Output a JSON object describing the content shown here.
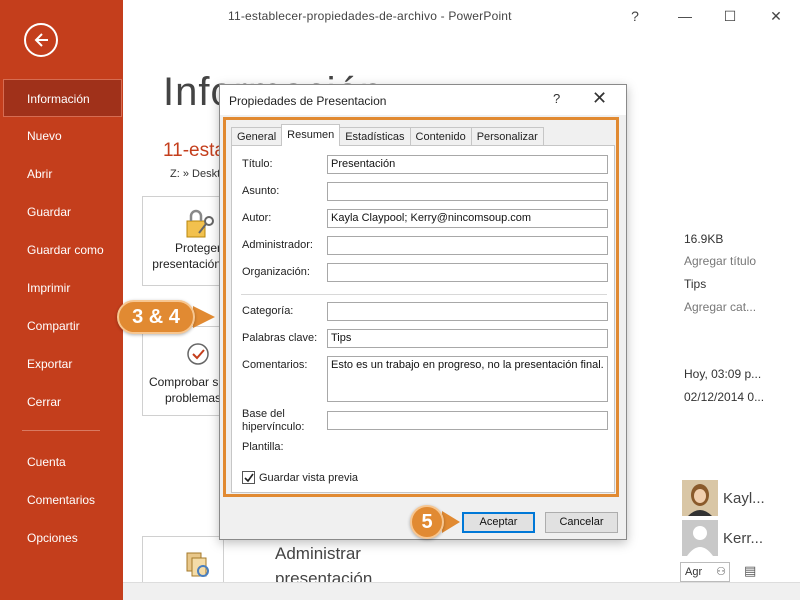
{
  "window": {
    "title": "11-establecer-propiedades-de-archivo - PowerPoint",
    "help": "?",
    "minimize": "—",
    "maximize": "☐",
    "close": "✕"
  },
  "sidebar": {
    "items": [
      {
        "label": "Información",
        "active": true
      },
      {
        "label": "Nuevo"
      },
      {
        "label": "Abrir"
      },
      {
        "label": "Guardar"
      },
      {
        "label": "Guardar como"
      },
      {
        "label": "Imprimir"
      },
      {
        "label": "Compartir"
      },
      {
        "label": "Exportar"
      },
      {
        "label": "Cerrar"
      },
      {
        "label": "Cuenta"
      },
      {
        "label": "Comentarios"
      },
      {
        "label": "Opciones"
      }
    ],
    "color": "#c43e1c"
  },
  "background": {
    "heading": "Información",
    "filename": "11-establecer-propiedades-de-archivo",
    "path": "Z: » Desktop",
    "protect_label_1": "Proteger",
    "protect_label_2": "presentación",
    "check_label_1": "Comprobar si",
    "check_label_2": "problemas",
    "manage_label_1": "Administrar",
    "manage_label_2": "presentación",
    "size": "16.9KB",
    "add_title": "Agregar título",
    "tags": "Tips",
    "add_category": "Agregar cat...",
    "modified": "Hoy, 03:09 p...",
    "created": "02/12/2014 0...",
    "stray_letter": "s",
    "author_1": "Kayl...",
    "author_2": "Kerr...",
    "add_author": "Agr"
  },
  "dialog": {
    "title": "Propiedades de Presentacion",
    "help": "?",
    "close": "✕",
    "tabs": [
      "General",
      "Resumen",
      "Estadísticas",
      "Contenido",
      "Personalizar"
    ],
    "active_tab": "Resumen",
    "fields": {
      "titulo_label": "Título:",
      "titulo_value": "Presentación",
      "asunto_label": "Asunto:",
      "asunto_value": "",
      "autor_label": "Autor:",
      "autor_value": "Kayla Claypool; Kerry@nincomsoup.com",
      "administrador_label": "Administrador:",
      "administrador_value": "",
      "organizacion_label": "Organización:",
      "organizacion_value": "",
      "categoria_label": "Categoría:",
      "categoria_value": "",
      "palabras_label": "Palabras clave:",
      "palabras_value": "Tips",
      "comentarios_label": "Comentarios:",
      "comentarios_value": "Esto es un trabajo en progreso, no la presentación final.",
      "base_label_1": "Base del",
      "base_label_2": "hipervínculo:",
      "base_value": "",
      "plantilla_label": "Plantilla:"
    },
    "save_preview_label": "Guardar vista previa",
    "save_preview_checked": true,
    "ok_label": "Aceptar",
    "cancel_label": "Cancelar"
  },
  "callouts": {
    "step_34": "3 & 4",
    "step_5": "5",
    "color": "#e18a32"
  }
}
